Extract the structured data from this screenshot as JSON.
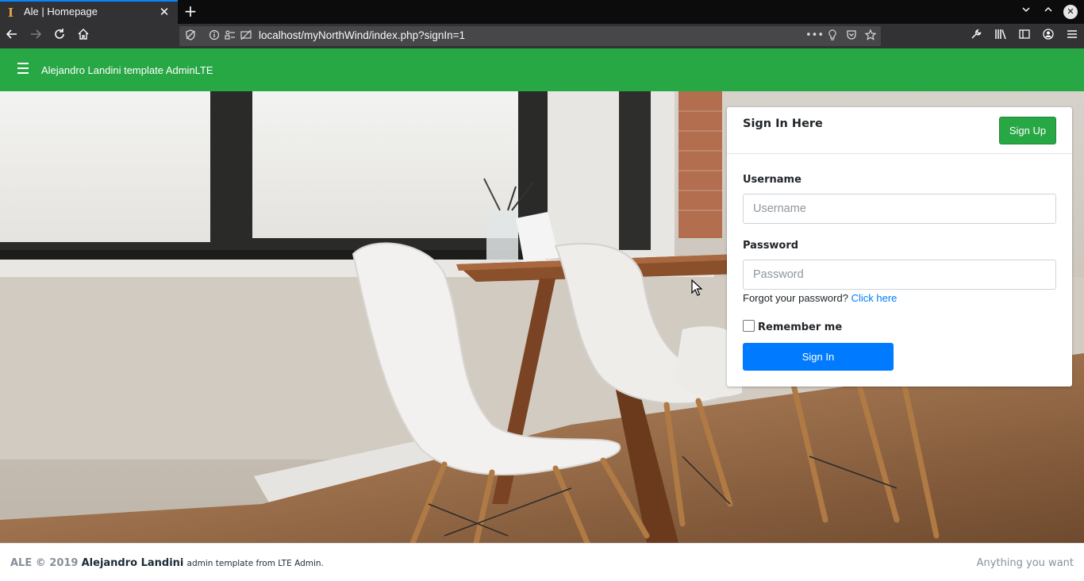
{
  "browser": {
    "tab_title": "Ale | Homepage",
    "tab_favicon": "I",
    "url": "localhost/myNorthWind/index.php?signIn=1",
    "tab_close_glyph": "✕",
    "new_tab_glyph": "+",
    "accent_color": "#0a84ff"
  },
  "header": {
    "brand": "Alejandro Landini template AdminLTE",
    "background_color": "#28a745"
  },
  "signin_card": {
    "title": "Sign In Here",
    "signup_label": "Sign Up",
    "username_label": "Username",
    "username_placeholder": "Username",
    "username_value": "",
    "password_label": "Password",
    "password_placeholder": "Password",
    "password_value": "",
    "forgot_text": "Forgot your password?",
    "forgot_link": "Click here",
    "remember_label": "Remember me",
    "remember_checked": false,
    "signin_label": "Sign In"
  },
  "footer": {
    "prefix": "ALE © 2019",
    "name": "Alejandro Landini",
    "suffix": "admin template from LTE Admin.",
    "right_text": "Anything you want"
  },
  "colors": {
    "success": "#28a745",
    "primary": "#007bff"
  }
}
